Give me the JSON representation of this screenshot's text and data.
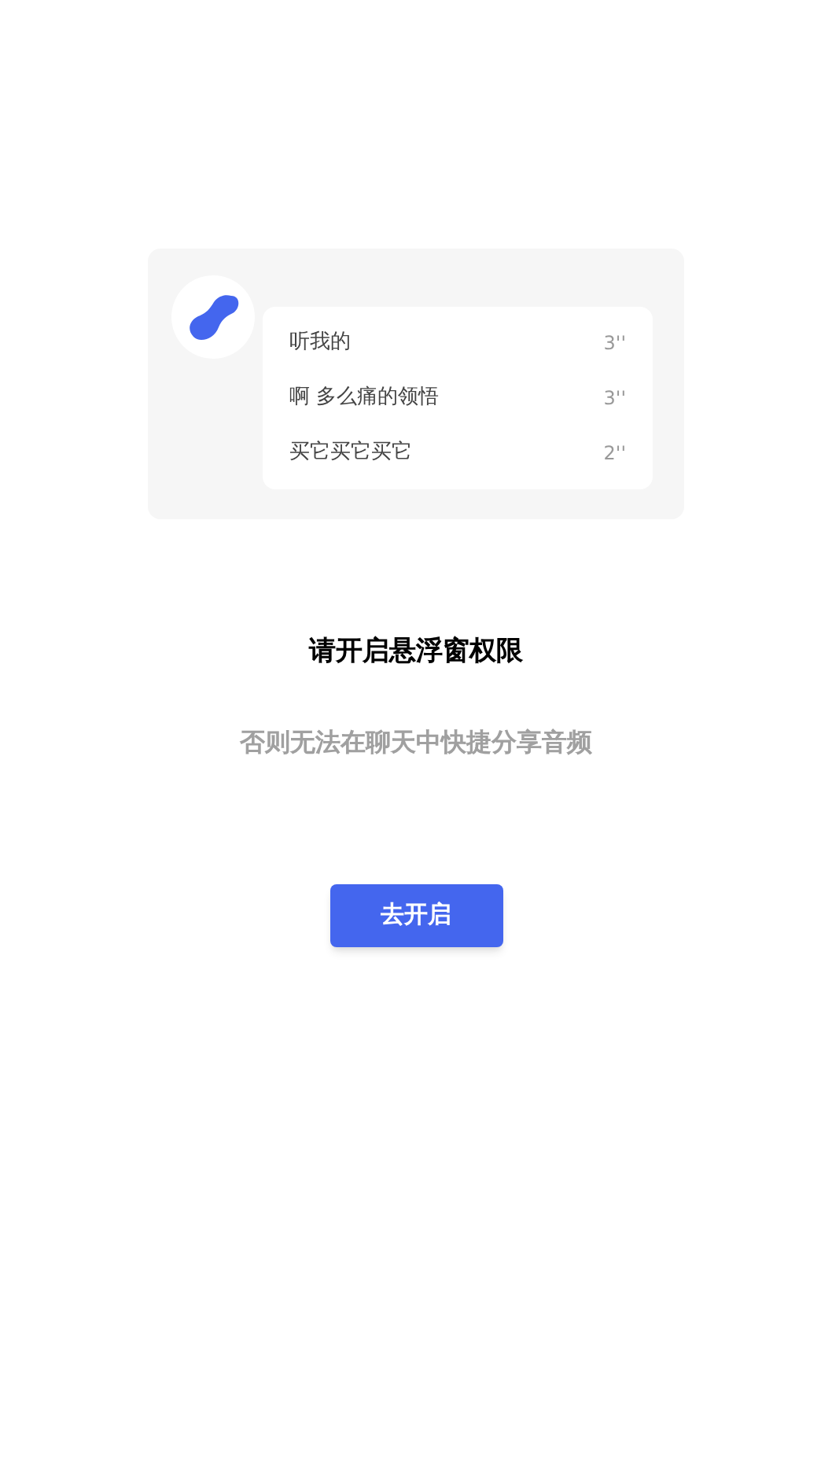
{
  "preview_card": {
    "messages": [
      {
        "text": "听我的",
        "duration": "3''"
      },
      {
        "text": "啊 多么痛的领悟",
        "duration": "3''"
      },
      {
        "text": "买它买它买它",
        "duration": "2''"
      }
    ]
  },
  "title": "请开启悬浮窗权限",
  "subtitle": "否则无法在聊天中快捷分享音频",
  "button": "去开启"
}
